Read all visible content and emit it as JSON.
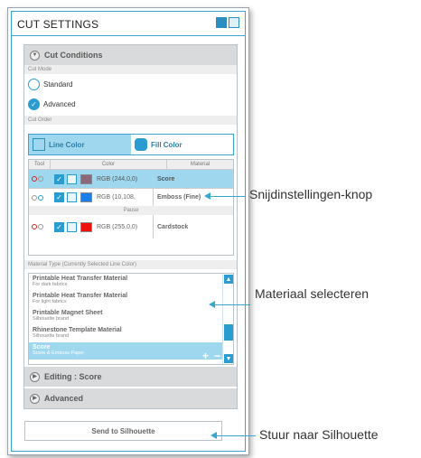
{
  "panel": {
    "title": "CUT SETTINGS"
  },
  "cut_conditions": {
    "header": "Cut Conditions",
    "cut_mode_label": "Cut Mode",
    "modes": [
      {
        "label": "Standard",
        "selected": false
      },
      {
        "label": "Advanced",
        "selected": true
      }
    ],
    "cut_order_label": "Cut Order",
    "tabs": [
      {
        "label": "Line Color",
        "active": true
      },
      {
        "label": "Fill Color",
        "active": false
      }
    ],
    "table": {
      "headers": [
        "Tool",
        "Color",
        "Material"
      ],
      "rows": [
        {
          "rgb": "RGB (244,0,0)",
          "color": "#8a6a78",
          "material": "Score",
          "selected": true
        },
        {
          "rgb": "RGB (10,108,",
          "color": "#1a7de8",
          "material": "Emboss (Fine)",
          "selected": false
        },
        {
          "rgb": "RGB (255,0,0)",
          "color": "#ef1010",
          "material": "Cardstock",
          "selected": false
        }
      ],
      "pause_label": "Pause"
    }
  },
  "material_type": {
    "label": "Material Type (Currently Selected Line Color)",
    "items": [
      {
        "name": "Printable Heat Transfer Material",
        "sub": "For dark fabrics"
      },
      {
        "name": "Printable Heat Transfer Material",
        "sub": "For light fabrics"
      },
      {
        "name": "Printable Magnet Sheet",
        "sub": "Silhouette brand"
      },
      {
        "name": "Rhinestone Template Material",
        "sub": "Silhouette brand"
      },
      {
        "name": "Score",
        "sub": "Score & Emboss Paper",
        "selected": true
      }
    ],
    "add": "+",
    "remove": "−"
  },
  "editing_header": "Editing : Score",
  "advanced_header": "Advanced",
  "send_button": "Send to Silhouette",
  "callouts": {
    "cut_settings_button": "Snijdinstellingen-knop",
    "select_material": "Materiaal selecteren",
    "send_to_silhouette": "Stuur naar Silhouette"
  },
  "colors": {
    "accent": "#2b9cd0",
    "selected_row": "#9fd8ee",
    "header_gray": "#d9dadb"
  }
}
